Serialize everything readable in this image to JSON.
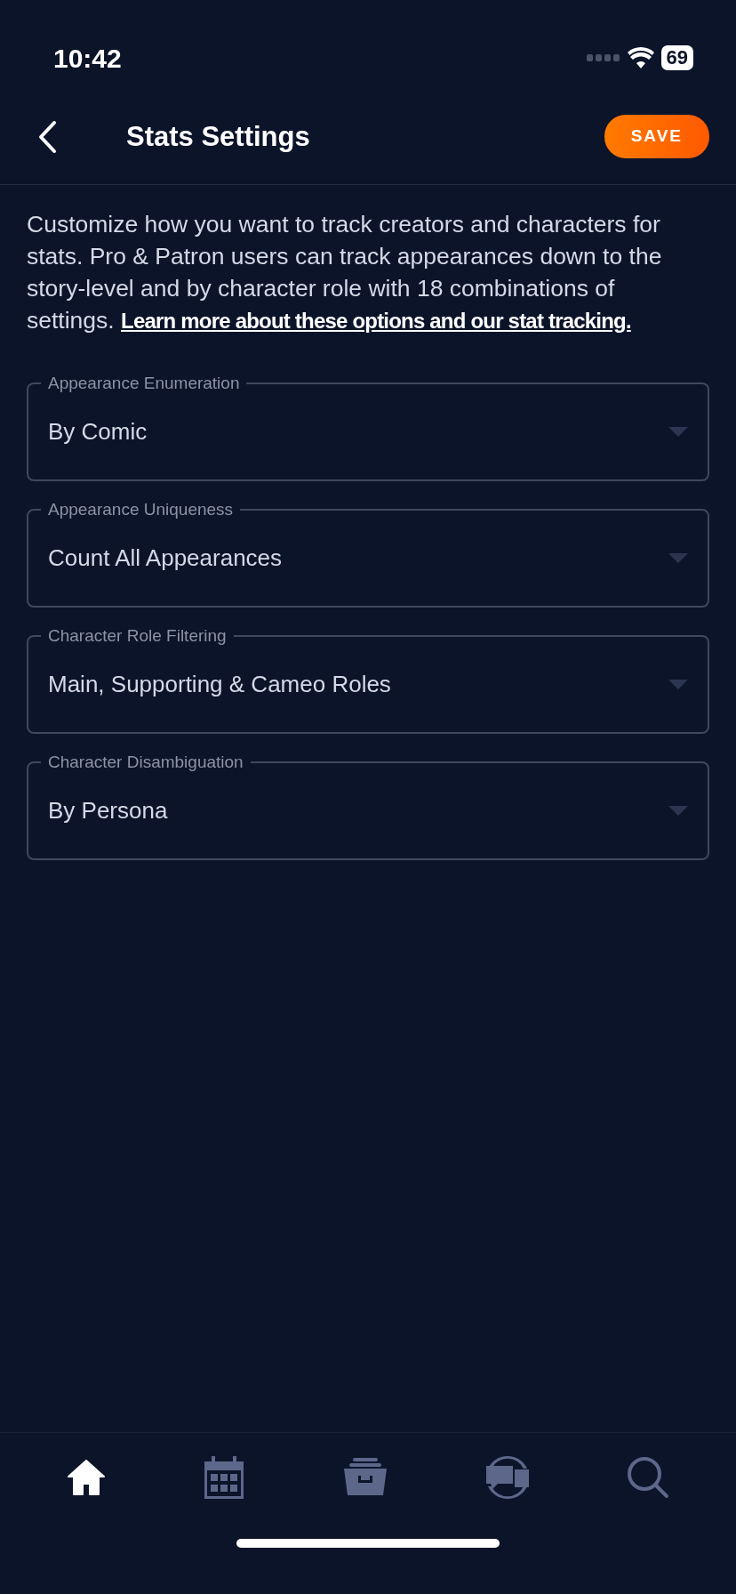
{
  "status_bar": {
    "time": "10:42",
    "battery": "69"
  },
  "header": {
    "title": "Stats Settings",
    "save_button": "SAVE"
  },
  "description": {
    "text": "Customize how you want to track creators and characters for stats. Pro & Patron users can track appearances down to the story-level and by character role with 18 combinations of settings.",
    "link": "Learn more about these options and our stat tracking."
  },
  "settings": [
    {
      "label": "Appearance Enumeration",
      "value": "By Comic"
    },
    {
      "label": "Appearance Uniqueness",
      "value": "Count All Appearances"
    },
    {
      "label": "Character Role Filtering",
      "value": "Main, Supporting & Cameo Roles"
    },
    {
      "label": "Character Disambiguation",
      "value": "By Persona"
    }
  ],
  "tab_bar": [
    {
      "kind": "home",
      "selected": true
    },
    {
      "kind": "calendar",
      "selected": false
    },
    {
      "kind": "collection",
      "selected": false
    },
    {
      "kind": "community",
      "selected": false
    },
    {
      "kind": "search",
      "selected": false
    }
  ]
}
